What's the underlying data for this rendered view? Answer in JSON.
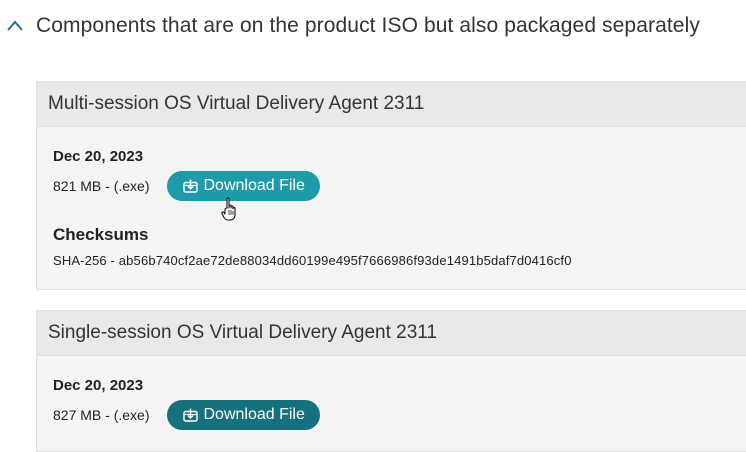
{
  "section": {
    "title": "Components that are on the product ISO but also packaged separately",
    "toggle_icon": "chevron-up-icon"
  },
  "cards": [
    {
      "title": "Multi-session OS Virtual Delivery Agent 2311",
      "date": "Dec 20, 2023",
      "size": "821 MB - (.exe)",
      "download_label": "Download File",
      "download_icon": "download-box-icon",
      "checksums_label": "Checksums",
      "checksum": "SHA-256 - ab56b740cf2ae72de88034dd60199e495f7666986f93de1491b5daf7d0416cf0"
    },
    {
      "title": "Single-session OS Virtual Delivery Agent 2311",
      "date": "Dec 20, 2023",
      "size": "827 MB - (.exe)",
      "download_label": "Download File",
      "download_icon": "download-box-icon"
    }
  ],
  "colors": {
    "button_hover": "#1f9aa8",
    "button_default": "#17707d",
    "card_bg": "#f4f4f4",
    "card_header_bg": "#e9e9e9"
  },
  "cursor": "hand-pointer-icon"
}
